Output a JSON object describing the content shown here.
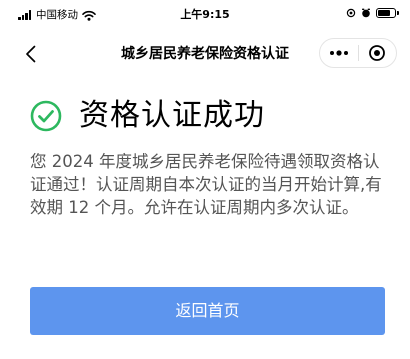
{
  "status_bar": {
    "carrier": "中国移动",
    "time": "上午9:15",
    "battery_level": 0.8
  },
  "nav": {
    "title": "城乡居民养老保险资格认证",
    "back_icon": "chevron-left-icon",
    "more_icon": "more-dots-icon",
    "close_icon": "mini-program-close-icon"
  },
  "result": {
    "icon": "check-circle-icon",
    "title": "资格认证成功",
    "description": "您 2024 年度城乡居民养老保险待遇领取资格认证通过！认证周期自本次认证的当月开始计算,有效期 12 个月。允许在认证周期内多次认证。"
  },
  "actions": {
    "home_label": "返回首页"
  },
  "colors": {
    "success": "#2db85f",
    "primary_button": "#5d95ee",
    "description_text": "#555555"
  }
}
